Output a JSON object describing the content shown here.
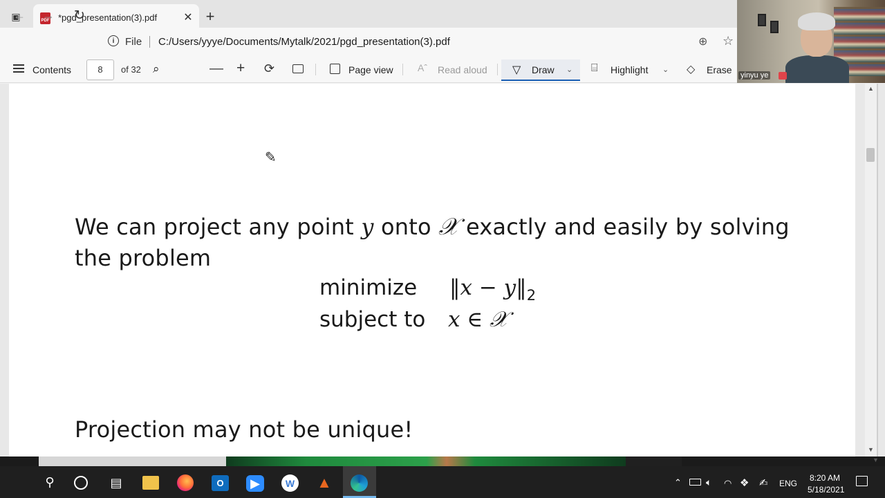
{
  "browser": {
    "tab_title": "*pgd_presentation(3).pdf",
    "tab_icon_text": "PDF",
    "close_glyph": "✕",
    "new_tab_glyph": "+",
    "file_label": "File",
    "url": "C:/Users/yyye/Documents/Mytalk/2021/pgd_presentation(3).pdf"
  },
  "pdf_toolbar": {
    "contents_label": "Contents",
    "page_number": "8",
    "page_total": "of 32",
    "page_view_label": "Page view",
    "read_aloud_label": "Read aloud",
    "draw_label": "Draw",
    "highlight_label": "Highlight",
    "erase_label": "Erase"
  },
  "document": {
    "line1_a": "We can project any point",
    "var_y": "y",
    "line1_b": "onto",
    "set_x": "𝒳",
    "line1_c": "exactly and easily by solving",
    "line2": "the problem",
    "minimize_label": "minimize",
    "objective": "‖x − y‖",
    "objective_sub": "2",
    "subject_to_label": "subject to",
    "constraint": "x ∈ 𝒳",
    "line3": "Projection may not be unique!"
  },
  "webcam": {
    "participant_name": "yinyu ye"
  },
  "taskbar": {
    "outlook_letter": "O",
    "wa_letter": "W",
    "language": "ENG",
    "time": "8:20 AM",
    "date": "5/18/2021"
  },
  "icons": {
    "window_menu": "window-menu-icon",
    "back": "back-arrow-icon",
    "forward": "forward-arrow-icon",
    "refresh": "refresh-icon",
    "info": "info-icon",
    "zoom": "zoom-icon",
    "favorite": "favorite-star-icon",
    "contents": "contents-list-icon",
    "search": "search-icon",
    "draw": "draw-pen-icon",
    "highlight": "highlighter-icon",
    "erase": "eraser-icon"
  },
  "colors": {
    "accent": "#1a5fb4",
    "pdf_badge": "#c4262e",
    "taskbar": "#1f1f1f"
  }
}
